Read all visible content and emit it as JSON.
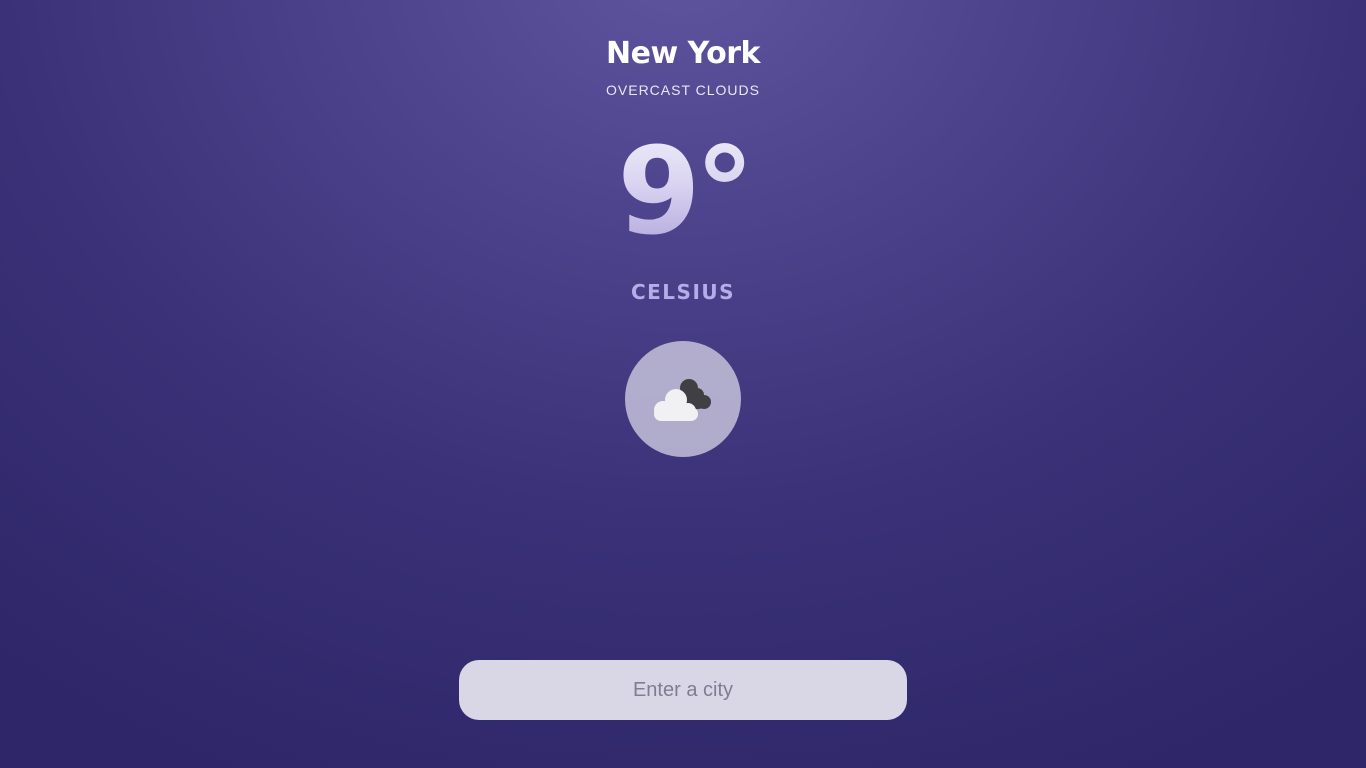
{
  "weather": {
    "city": "New York",
    "condition": "OVERCAST CLOUDS",
    "temperature": "9°",
    "unit": "CELSIUS",
    "icon": "overcast-clouds-icon"
  },
  "search": {
    "placeholder": "Enter a city",
    "value": ""
  },
  "colors": {
    "background_light": "#5f559f",
    "background_dark": "#2e2668",
    "unit_text": "#b7acea",
    "icon_circle": "#c9c6dd",
    "search_bg": "#d9d6e6"
  }
}
